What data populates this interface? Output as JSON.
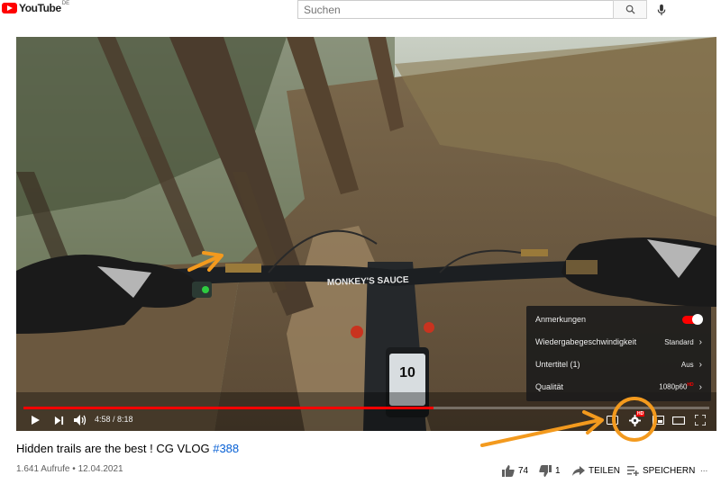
{
  "header": {
    "logo_text": "YouTube",
    "logo_country": "DE",
    "search_placeholder": "Suchen"
  },
  "player": {
    "time_current": "4:58",
    "time_separator": " / ",
    "time_total": "8:18",
    "progress": 0.598
  },
  "settings_menu": {
    "rows": [
      {
        "label": "Anmerkungen",
        "value": "",
        "toggle_on": true
      },
      {
        "label": "Wiedergabegeschwindigkeit",
        "value": "Standard"
      },
      {
        "label": "Untertitel (1)",
        "value": "Aus"
      },
      {
        "label": "Qualität",
        "value": "1080p60",
        "badge": "HD"
      }
    ],
    "chevron": "›"
  },
  "video_text": {
    "handlebar": "MONKEY'S SAUCE",
    "display_number": "10"
  },
  "video_info": {
    "title": "Hidden trails are the best ! CG VLOG ",
    "hashtag": "#388",
    "views": "1.641 Aufrufe",
    "dot": " • ",
    "date": "12.04.2021"
  },
  "actions": {
    "likes": "74",
    "dislikes": "1",
    "share": "TEILEN",
    "save": "SPEICHERN",
    "more": "..."
  },
  "colors": {
    "brand_red": "#ff0000",
    "annotation_orange": "#f39a1e",
    "link_blue": "#065fd4"
  }
}
